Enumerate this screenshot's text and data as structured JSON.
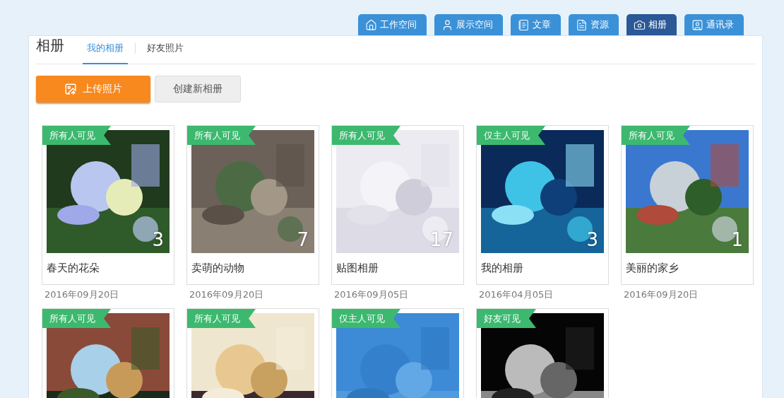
{
  "nav_tabs": [
    {
      "label": "工作空间",
      "kind": "home",
      "selected": false
    },
    {
      "label": "展示空间",
      "kind": "user",
      "selected": false
    },
    {
      "label": "文章",
      "kind": "notebook",
      "selected": false
    },
    {
      "label": "资源",
      "kind": "file",
      "selected": false
    },
    {
      "label": "相册",
      "kind": "camera",
      "selected": true
    },
    {
      "label": "通讯录",
      "kind": "contact",
      "selected": false
    }
  ],
  "page_title": "相册",
  "sub_tabs": [
    {
      "label": "我的相册",
      "selected": true
    },
    {
      "label": "好友照片",
      "selected": false
    }
  ],
  "buttons": [
    {
      "kind": "primary",
      "label": "上传照片"
    },
    {
      "kind": "secondary",
      "label": "创建新相册"
    }
  ],
  "albums": [
    {
      "visibility": "所有人可见",
      "title": "春天的花朵",
      "count": "3",
      "date": "2016年09月20日"
    },
    {
      "visibility": "所有人可见",
      "title": "卖萌的动物",
      "count": "7",
      "date": "2016年09月20日"
    },
    {
      "visibility": "所有人可见",
      "title": "贴图相册",
      "count": "17",
      "date": "2016年09月05日"
    },
    {
      "visibility": "仅主人可见",
      "title": "我的相册",
      "count": "3",
      "date": "2016年04月05日"
    },
    {
      "visibility": "所有人可见",
      "title": "美丽的家乡",
      "count": "1",
      "date": "2016年09月20日"
    },
    {
      "visibility": "所有人可见"
    },
    {
      "visibility": "所有人可见"
    },
    {
      "visibility": "仅主人可见"
    },
    {
      "visibility": "好友可见"
    }
  ]
}
